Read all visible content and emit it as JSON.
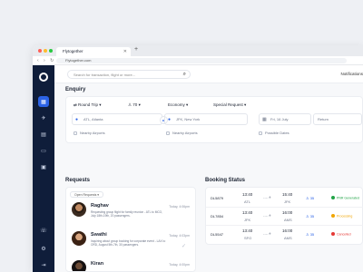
{
  "browser": {
    "tab_title": "Flytogether",
    "url": "Flytogether.com"
  },
  "topbar": {
    "search_placeholder": "Search for transaction, flight or more...",
    "notifications_label": "Notifications"
  },
  "enquiry": {
    "title": "Enquiry",
    "trip_type": "Round Trip",
    "passengers": "70",
    "cabin_class": "Economy",
    "special_request": "Special Request",
    "from_value": "ATL, Atlanta",
    "to_value": "JFK, New York",
    "depart_date": "Fri, 16 July",
    "return_placeholder": "Return",
    "check_from": "Nearby Airports",
    "check_to": "Nearby Airports",
    "check_dates": "Possible Dates"
  },
  "requests": {
    "title": "Requests",
    "filter_label": "Open Requests",
    "items": [
      {
        "name": "Raghav",
        "message": "Requesting group flight for family reunion - ATL to MCO, July 18th-19th, 20 passengers.",
        "time": "Today, 4:06pm"
      },
      {
        "name": "Swathi",
        "message": "Inquiring about group booking for corporate event - LAX to ORD, August 5th-7th, 30 passengers.",
        "time": "Today, 4:03pm"
      },
      {
        "name": "Kiran",
        "message": "",
        "time": "Today, 4:00pm"
      }
    ]
  },
  "booking": {
    "title": "Booking Status",
    "rows": [
      {
        "id": "DL5879",
        "dep_time": "13:40",
        "dep_code": "ATL",
        "arr_time": "15:40",
        "arr_code": "JFK",
        "pax": "35",
        "status": "PNR Generated",
        "status_color": "#22a447"
      },
      {
        "id": "DL7854",
        "dep_time": "13:40",
        "dep_code": "JFK",
        "arr_time": "16:00",
        "arr_code": "AMS",
        "pax": "35",
        "status": "Processing",
        "status_color": "#f0a500"
      },
      {
        "id": "DL5547",
        "dep_time": "13:40",
        "dep_code": "SFO",
        "arr_time": "16:00",
        "arr_code": "AMS",
        "pax": "35",
        "status": "Cancelled",
        "status_color": "#e53935"
      }
    ]
  },
  "colors": {
    "accent": "#2c63e6",
    "sidebar": "#0f1d3a"
  }
}
